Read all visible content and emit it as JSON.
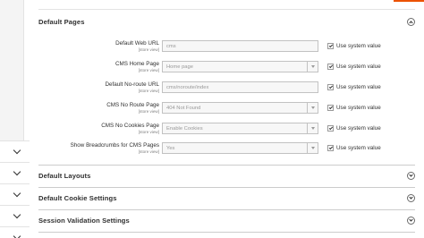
{
  "sections": {
    "default_pages": {
      "title": "Default Pages"
    },
    "default_layouts": {
      "title": "Default Layouts"
    },
    "default_cookie": {
      "title": "Default Cookie Settings"
    },
    "session_validation": {
      "title": "Session Validation Settings"
    }
  },
  "fields": [
    {
      "label": "Default Web URL",
      "scope": "[store view]",
      "value": "cms",
      "type": "text",
      "use_system": "Use system value",
      "checked": true
    },
    {
      "label": "CMS Home Page",
      "scope": "[store view]",
      "value": "Home page",
      "type": "select",
      "use_system": "Use system value",
      "checked": true
    },
    {
      "label": "Default No-route URL",
      "scope": "[store view]",
      "value": "cms/noroute/index",
      "type": "text",
      "use_system": "Use system value",
      "checked": true
    },
    {
      "label": "CMS No Route Page",
      "scope": "[store view]",
      "value": "404 Not Found",
      "type": "select",
      "use_system": "Use system value",
      "checked": true
    },
    {
      "label": "CMS No Cookies Page",
      "scope": "[store view]",
      "value": "Enable Cookies",
      "type": "select",
      "use_system": "Use system value",
      "checked": true
    },
    {
      "label": "Show Breadcrumbs for CMS Pages",
      "scope": "[store view]",
      "value": "Yes",
      "type": "select",
      "use_system": "Use system value",
      "checked": true
    }
  ],
  "colors": {
    "accent": "#eb5202",
    "text": "#303030",
    "muted": "#999999"
  }
}
